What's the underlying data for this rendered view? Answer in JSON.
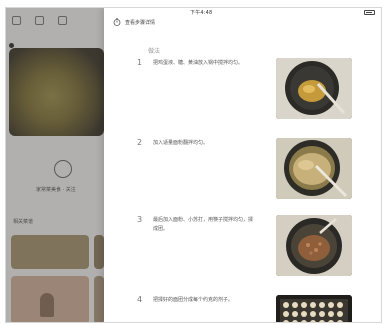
{
  "status_bar": {
    "time": "下午4:48"
  },
  "background_app": {
    "chef_caption": "家常菜美食 · 关注",
    "section_title": "相关菜谱"
  },
  "panel": {
    "title": "查看步骤详情",
    "steps_label": "做法",
    "steps": [
      {
        "number": "1",
        "text": "把鸡蛋液、糖、黄油放入锅中搅拌均匀。"
      },
      {
        "number": "2",
        "text": "加入适量面粉翻拌均匀。"
      },
      {
        "number": "3",
        "text": "最后加入面粉、小苏打，用筷子搅拌均匀，揉成团。"
      },
      {
        "number": "4",
        "text": "把揉好的面团分成每个约克的剂子。"
      }
    ]
  },
  "colors": {
    "panel_bg": "#ffffff",
    "dim_overlay": "#3c3c3c",
    "step_number": "#777777"
  },
  "icons": {
    "header_icon": "timer-icon",
    "battery": "battery-icon"
  }
}
